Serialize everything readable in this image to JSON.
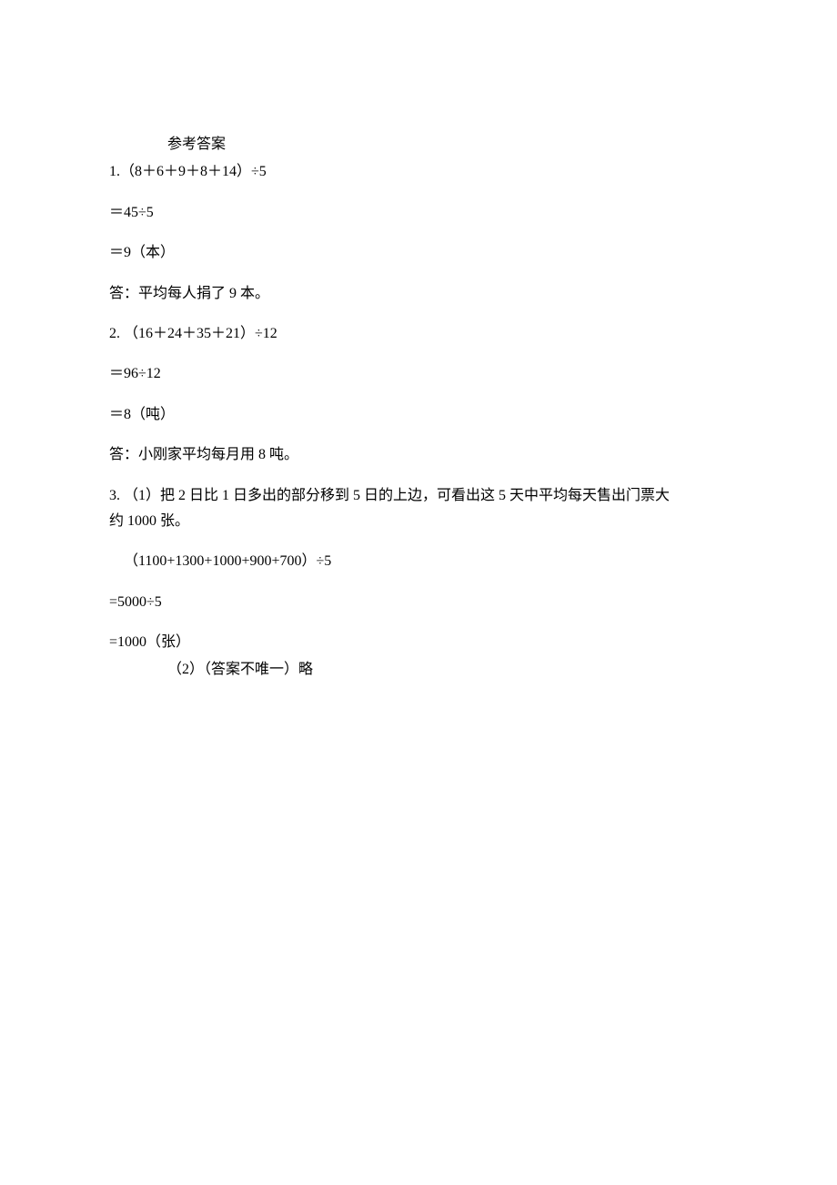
{
  "title": "参考答案",
  "q1": {
    "head": "1.（8＋6＋9＋8＋14）÷5",
    "step1": "＝45÷5",
    "step2": "＝9（本）",
    "answer": "答：平均每人捐了 9 本。"
  },
  "q2": {
    "head": "2.  （16＋24＋35＋21）÷12",
    "step1": "＝96÷12",
    "step2": "＝8（吨）",
    "answer": "答：小刚家平均每月用 8 吨。"
  },
  "q3": {
    "head_line1": "3.   （1）把 2 日比 1 日多出的部分移到 5 日的上边，可看出这 5 天中平均每天售出门票大",
    "head_line2": "约 1000 张。",
    "expr": "（1100+1300+1000+900+700）÷5",
    "step1": "=5000÷5",
    "step2": "=1000（张）",
    "part2": "（2）（答案不唯一）略"
  }
}
